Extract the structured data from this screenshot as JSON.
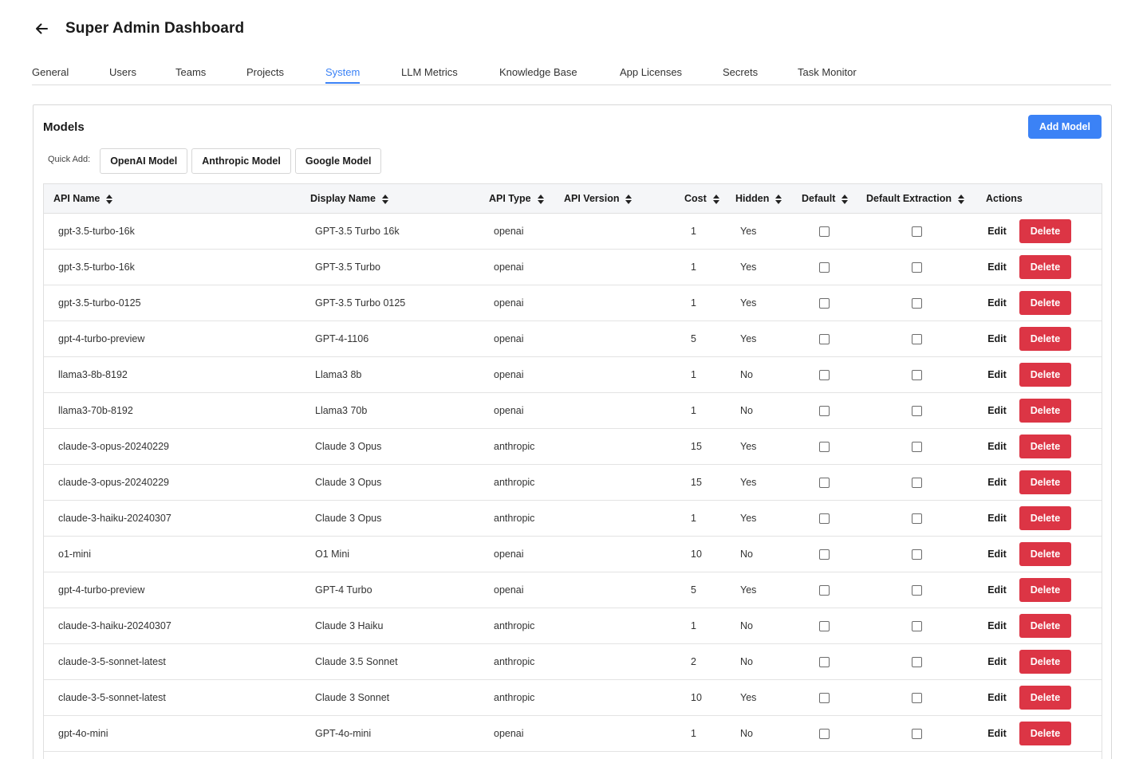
{
  "header": {
    "title": "Super Admin Dashboard",
    "back_icon": "arrow-left-icon"
  },
  "tabs": [
    {
      "label": "General",
      "active": false
    },
    {
      "label": "Users",
      "active": false
    },
    {
      "label": "Teams",
      "active": false
    },
    {
      "label": "Projects",
      "active": false
    },
    {
      "label": "System",
      "active": true
    },
    {
      "label": "LLM Metrics",
      "active": false
    },
    {
      "label": "Knowledge Base",
      "active": false
    },
    {
      "label": "App Licenses",
      "active": false
    },
    {
      "label": "Secrets",
      "active": false
    },
    {
      "label": "Task Monitor",
      "active": false
    }
  ],
  "models": {
    "title": "Models",
    "add_button": "Add Model",
    "quick_add_label": "Quick Add:",
    "quick_add_buttons": [
      "OpenAI Model",
      "Anthropic Model",
      "Google Model"
    ],
    "columns": [
      "API Name",
      "Display Name",
      "API Type",
      "API Version",
      "Cost",
      "Hidden",
      "Default",
      "Default Extraction",
      "Actions"
    ],
    "edit_label": "Edit",
    "delete_label": "Delete",
    "rows": [
      {
        "api_name": "gpt-3.5-turbo-16k",
        "display_name": "GPT-3.5 Turbo 16k",
        "api_type": "openai",
        "api_version": "",
        "cost": "1",
        "hidden": "Yes",
        "default": false,
        "default_extraction": false
      },
      {
        "api_name": "gpt-3.5-turbo-16k",
        "display_name": "GPT-3.5 Turbo",
        "api_type": "openai",
        "api_version": "",
        "cost": "1",
        "hidden": "Yes",
        "default": false,
        "default_extraction": false
      },
      {
        "api_name": "gpt-3.5-turbo-0125",
        "display_name": "GPT-3.5 Turbo 0125",
        "api_type": "openai",
        "api_version": "",
        "cost": "1",
        "hidden": "Yes",
        "default": false,
        "default_extraction": false
      },
      {
        "api_name": "gpt-4-turbo-preview",
        "display_name": "GPT-4-1106",
        "api_type": "openai",
        "api_version": "",
        "cost": "5",
        "hidden": "Yes",
        "default": false,
        "default_extraction": false
      },
      {
        "api_name": "llama3-8b-8192",
        "display_name": "Llama3 8b",
        "api_type": "openai",
        "api_version": "",
        "cost": "1",
        "hidden": "No",
        "default": false,
        "default_extraction": false
      },
      {
        "api_name": "llama3-70b-8192",
        "display_name": "Llama3 70b",
        "api_type": "openai",
        "api_version": "",
        "cost": "1",
        "hidden": "No",
        "default": false,
        "default_extraction": false
      },
      {
        "api_name": "claude-3-opus-20240229",
        "display_name": "Claude 3 Opus",
        "api_type": "anthropic",
        "api_version": "",
        "cost": "15",
        "hidden": "Yes",
        "default": false,
        "default_extraction": false
      },
      {
        "api_name": "claude-3-opus-20240229",
        "display_name": "Claude 3 Opus",
        "api_type": "anthropic",
        "api_version": "",
        "cost": "15",
        "hidden": "Yes",
        "default": false,
        "default_extraction": false
      },
      {
        "api_name": "claude-3-haiku-20240307",
        "display_name": "Claude 3 Opus",
        "api_type": "anthropic",
        "api_version": "",
        "cost": "1",
        "hidden": "Yes",
        "default": false,
        "default_extraction": false
      },
      {
        "api_name": "o1-mini",
        "display_name": "O1 Mini",
        "api_type": "openai",
        "api_version": "",
        "cost": "10",
        "hidden": "No",
        "default": false,
        "default_extraction": false
      },
      {
        "api_name": "gpt-4-turbo-preview",
        "display_name": "GPT-4 Turbo",
        "api_type": "openai",
        "api_version": "",
        "cost": "5",
        "hidden": "Yes",
        "default": false,
        "default_extraction": false
      },
      {
        "api_name": "claude-3-haiku-20240307",
        "display_name": "Claude 3 Haiku",
        "api_type": "anthropic",
        "api_version": "",
        "cost": "1",
        "hidden": "No",
        "default": false,
        "default_extraction": false
      },
      {
        "api_name": "claude-3-5-sonnet-latest",
        "display_name": "Claude 3.5 Sonnet",
        "api_type": "anthropic",
        "api_version": "",
        "cost": "2",
        "hidden": "No",
        "default": false,
        "default_extraction": false
      },
      {
        "api_name": "claude-3-5-sonnet-latest",
        "display_name": "Claude 3 Sonnet",
        "api_type": "anthropic",
        "api_version": "",
        "cost": "10",
        "hidden": "Yes",
        "default": false,
        "default_extraction": false
      },
      {
        "api_name": "gpt-4o-mini",
        "display_name": "GPT-4o-mini",
        "api_type": "openai",
        "api_version": "",
        "cost": "1",
        "hidden": "No",
        "default": false,
        "default_extraction": false
      }
    ]
  },
  "colors": {
    "accent": "#3b82f6",
    "danger": "#dc3545"
  }
}
